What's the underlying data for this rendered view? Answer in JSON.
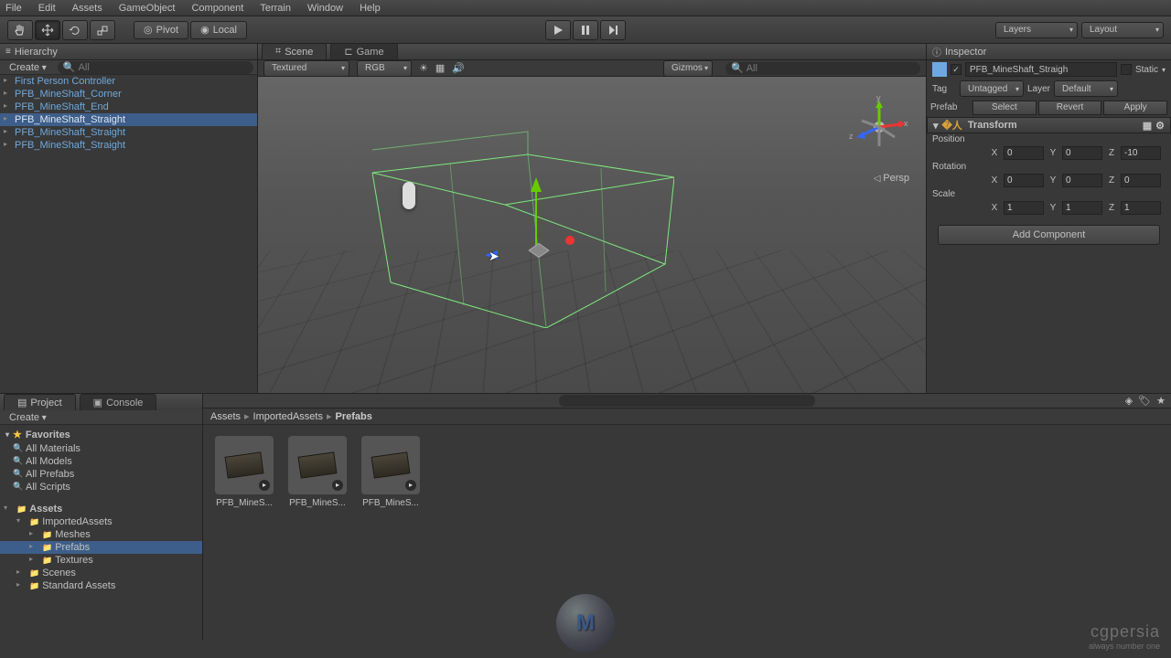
{
  "menu": [
    "File",
    "Edit",
    "Assets",
    "GameObject",
    "Component",
    "Terrain",
    "Window",
    "Help"
  ],
  "toolbar": {
    "pivot": "Pivot",
    "local": "Local",
    "layers": "Layers",
    "layout": "Layout"
  },
  "hierarchy": {
    "title": "Hierarchy",
    "create": "Create",
    "search_placeholder": "All",
    "items": [
      {
        "name": "First Person Controller",
        "selected": false
      },
      {
        "name": "PFB_MineShaft_Corner",
        "selected": false
      },
      {
        "name": "PFB_MineShaft_End",
        "selected": false
      },
      {
        "name": "PFB_MineShaft_Straight",
        "selected": true
      },
      {
        "name": "PFB_MineShaft_Straight",
        "selected": false
      },
      {
        "name": "PFB_MineShaft_Straight",
        "selected": false
      }
    ]
  },
  "scene": {
    "tab_scene": "Scene",
    "tab_game": "Game",
    "shading": "Textured",
    "render": "RGB",
    "gizmos": "Gizmos",
    "search_placeholder": "All",
    "persp": "Persp",
    "axis_y": "y",
    "axis_x": "x",
    "axis_z": "z"
  },
  "inspector": {
    "title": "Inspector",
    "object_name": "PFB_MineShaft_Straigh",
    "static": "Static",
    "tag_label": "Tag",
    "tag": "Untagged",
    "layer_label": "Layer",
    "layer": "Default",
    "prefab_label": "Prefab",
    "select": "Select",
    "revert": "Revert",
    "apply": "Apply",
    "transform": "Transform",
    "position": "Position",
    "rotation": "Rotation",
    "scale": "Scale",
    "pos": {
      "x": "0",
      "y": "0",
      "z": "-10"
    },
    "rot": {
      "x": "0",
      "y": "0",
      "z": "0"
    },
    "scl": {
      "x": "1",
      "y": "1",
      "z": "1"
    },
    "add_component": "Add Component"
  },
  "project": {
    "tab_project": "Project",
    "tab_console": "Console",
    "create": "Create",
    "favorites": "Favorites",
    "fav_items": [
      "All Materials",
      "All Models",
      "All Prefabs",
      "All Scripts"
    ],
    "assets": "Assets",
    "tree": [
      {
        "name": "ImportedAssets",
        "level": 2,
        "open": true
      },
      {
        "name": "Meshes",
        "level": 3,
        "open": false
      },
      {
        "name": "Prefabs",
        "level": 3,
        "open": false,
        "selected": true
      },
      {
        "name": "Textures",
        "level": 3,
        "open": false
      },
      {
        "name": "Scenes",
        "level": 2,
        "open": false
      },
      {
        "name": "Standard Assets",
        "level": 2,
        "open": false
      }
    ],
    "breadcrumb": [
      "Assets",
      "ImportedAssets",
      "Prefabs"
    ],
    "grid": [
      "PFB_MineS...",
      "PFB_MineS...",
      "PFB_MineS..."
    ]
  },
  "watermark": {
    "big": "cgpersia",
    "small": "always number one"
  }
}
